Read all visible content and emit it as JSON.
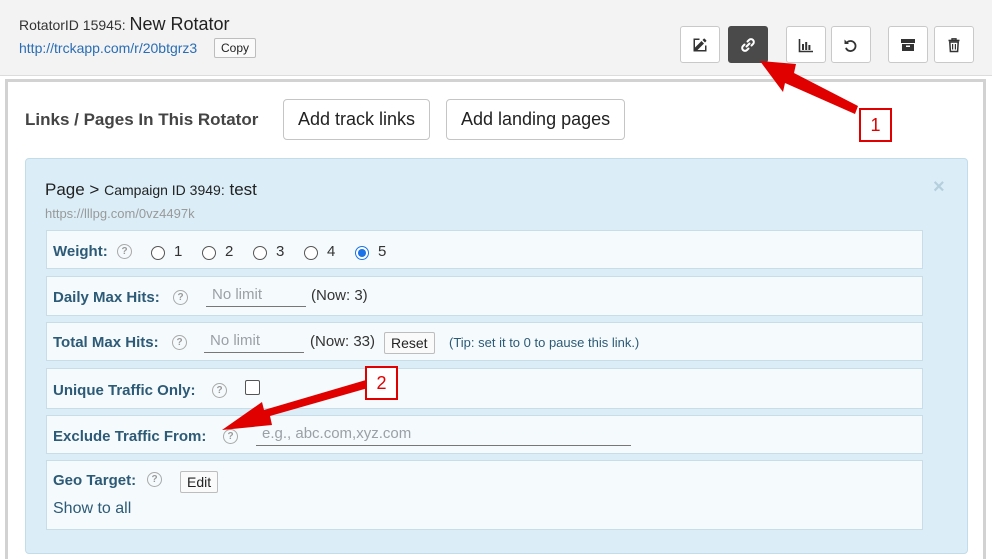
{
  "header": {
    "rotator_prefix": "RotatorID 15945:",
    "rotator_name": "New Rotator",
    "url": "http://trckapp.com/r/20btgrz3",
    "copy_label": "Copy"
  },
  "toolbar": {
    "buttons": [
      {
        "name": "edit",
        "icon": "edit-icon"
      },
      {
        "name": "link",
        "icon": "link-icon",
        "active": true
      },
      {
        "name": "stats",
        "icon": "bar-chart-icon"
      },
      {
        "name": "reset",
        "icon": "undo-icon"
      },
      {
        "name": "archive",
        "icon": "archive-icon"
      },
      {
        "name": "delete",
        "icon": "trash-icon"
      }
    ]
  },
  "section": {
    "title": "Links / Pages In This Rotator",
    "add_track_links": "Add track links",
    "add_landing_pages": "Add landing pages"
  },
  "page": {
    "prefix": "Page >",
    "campaign": "Campaign ID 3949:",
    "name": "test",
    "url": "https://lllpg.com/0vz4497k",
    "close": "×"
  },
  "weight": {
    "label": "Weight:",
    "options": [
      "1",
      "2",
      "3",
      "4",
      "5"
    ],
    "selected": "5"
  },
  "daily": {
    "label": "Daily Max Hits:",
    "placeholder": "No limit",
    "now": "(Now: 3)"
  },
  "total": {
    "label": "Total Max Hits:",
    "placeholder": "No limit",
    "now": "(Now: 33)",
    "reset_label": "Reset",
    "tip": "(Tip: set it to 0 to pause this link.)"
  },
  "unique": {
    "label": "Unique Traffic Only:",
    "checked": false
  },
  "exclude": {
    "label": "Exclude Traffic From:",
    "placeholder": "e.g., abc.com,xyz.com"
  },
  "geo": {
    "label": "Geo Target:",
    "edit_label": "Edit",
    "show_text": "Show to all"
  },
  "help_glyph": "?",
  "annotations": {
    "callout_1": "1",
    "callout_2": "2",
    "color": "#e00000"
  }
}
